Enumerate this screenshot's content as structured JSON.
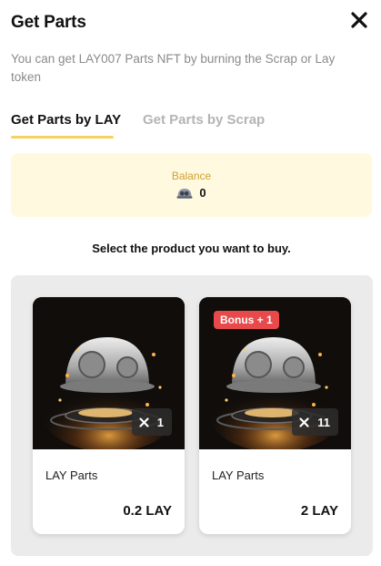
{
  "dialog": {
    "title": "Get Parts",
    "description": "You can get LAY007 Parts NFT by burning the Scrap or Lay token"
  },
  "tabs": [
    {
      "label": "Get Parts by LAY",
      "active": true
    },
    {
      "label": "Get Parts by Scrap",
      "active": false
    }
  ],
  "balance": {
    "label": "Balance",
    "icon": "helmet-token-icon",
    "value": "0"
  },
  "prompt": "Select the product you want to buy.",
  "products": [
    {
      "name": "LAY Parts",
      "price": "0.2 LAY",
      "quantity": "1",
      "badge": ""
    },
    {
      "name": "LAY Parts",
      "price": "2 LAY",
      "quantity": "11",
      "badge": "Bonus + 1"
    }
  ],
  "colors": {
    "accent": "#f4d35e",
    "balance_bg": "#fff9df",
    "balance_label": "#cfa132",
    "badge": "#e8494a",
    "panel_bg": "#ebebeb"
  }
}
